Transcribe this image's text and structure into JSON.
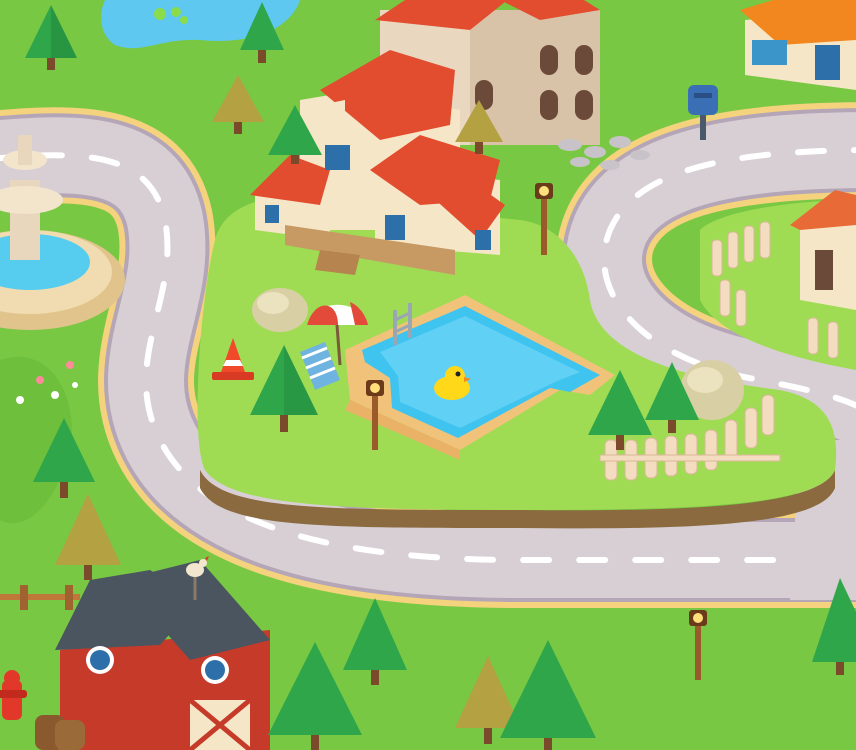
{
  "scene": {
    "title": "",
    "palette": {
      "grass": "#79c843",
      "grass_dark": "#5aae31",
      "grass_light": "#9fdc54",
      "road": "#d7cfd4",
      "road_edge": "#b5a6b7",
      "curb": "#f4d27e",
      "water": "#3fc3ef",
      "pond": "#5ec8f1",
      "roof_red": "#e24d2f",
      "roof_orange": "#f2871f",
      "wall_cream": "#f6e6c8",
      "barn_red": "#c63a2a",
      "barn_roof": "#4b5560",
      "tree": "#2fa64a",
      "tree_dark": "#1f7d38",
      "tree_olive": "#b3a142",
      "fence": "#f3dcc0",
      "lamp": "#9a5a2a"
    },
    "icons": [
      "fountain-icon",
      "mansion-icon",
      "tower-house-icon",
      "orange-roof-cottage-icon",
      "small-house-icon",
      "barn-icon",
      "swimming-pool-icon",
      "rubber-duck-icon",
      "beach-umbrella-icon",
      "deck-chair-icon",
      "traffic-cone-icon",
      "mailbox-icon",
      "street-lamp-icon",
      "fire-hydrant-icon",
      "fence-icon",
      "rock-icon",
      "tree-icon",
      "pond-icon"
    ]
  }
}
